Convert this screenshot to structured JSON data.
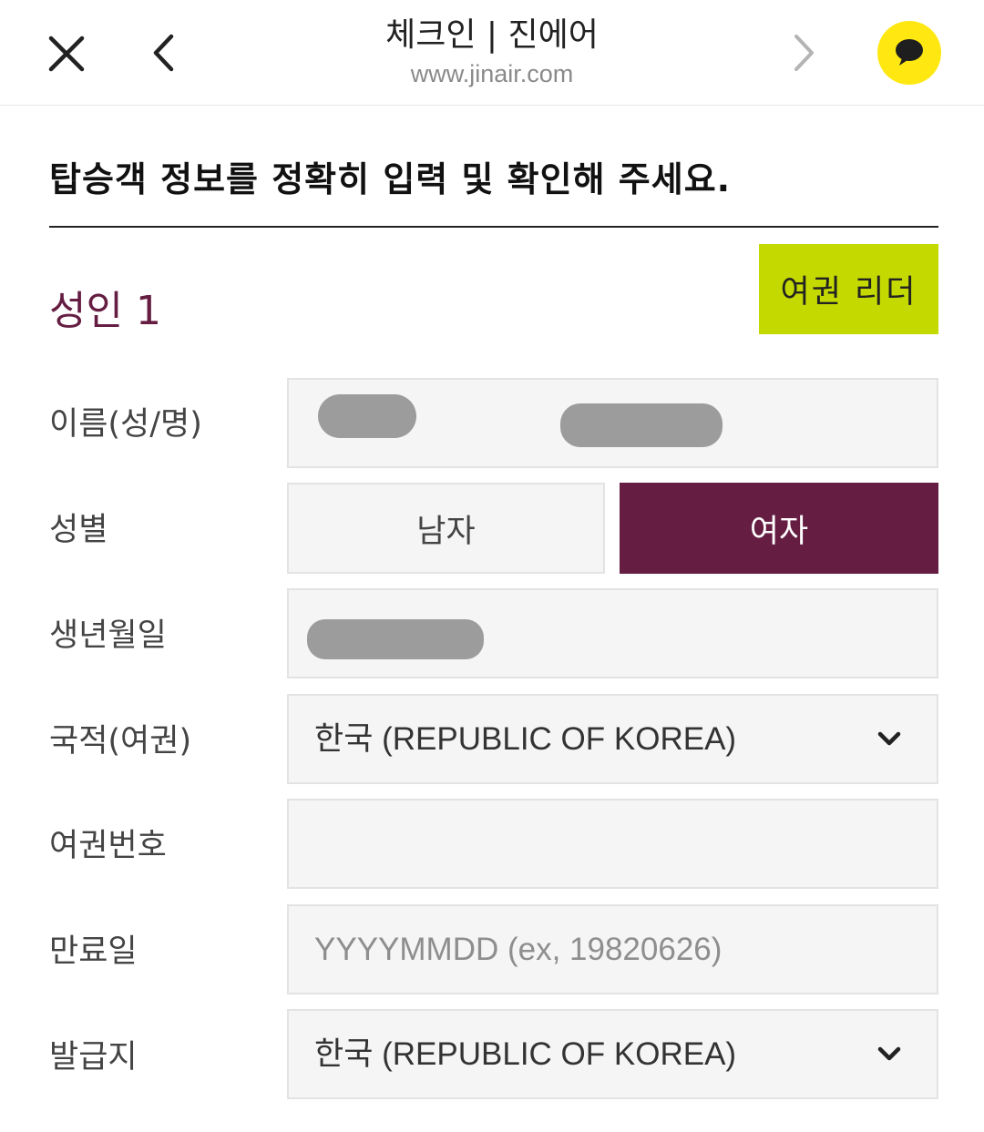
{
  "browser": {
    "title": "체크인 | 진에어",
    "url": "www.jinair.com",
    "colors": {
      "chat_button": "#ffe812"
    },
    "icons": [
      "close-icon",
      "back-arrow-icon",
      "forward-arrow-icon",
      "chat-bubble-icon"
    ]
  },
  "page": {
    "heading": "탑승객 정보를 정확히 입력 및 확인해 주세요.",
    "passenger_label": "성인 1",
    "passport_reader_label": "여권 리더",
    "colors": {
      "accent": "#651d42",
      "reader_button": "#c4d900"
    }
  },
  "form": {
    "name": {
      "label": "이름(성/명)",
      "value_redacted": true
    },
    "gender": {
      "label": "성별",
      "options": [
        "남자",
        "여자"
      ],
      "selected": "여자"
    },
    "birth": {
      "label": "생년월일",
      "value_redacted": true
    },
    "nationality": {
      "label": "국적(여권)",
      "value": "한국 (REPUBLIC OF KOREA)"
    },
    "passport_number": {
      "label": "여권번호",
      "value": ""
    },
    "expiry": {
      "label": "만료일",
      "placeholder": "YYYYMMDD (ex, 19820626)"
    },
    "issuing_country": {
      "label": "발급지",
      "value": "한국 (REPUBLIC OF KOREA)"
    }
  }
}
